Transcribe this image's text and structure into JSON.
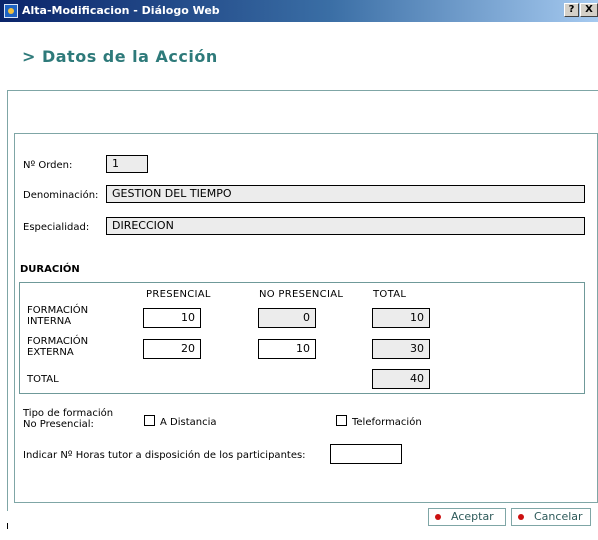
{
  "window": {
    "title": "Alta-Modificacion - Diálogo Web",
    "help_label": "?",
    "close_label": "X"
  },
  "heading": "> Datos de la Acción",
  "fields": {
    "orden": {
      "label": "Nº Orden:",
      "value": "1"
    },
    "denominacion": {
      "label": "Denominación:",
      "value": "GESTION DEL TIEMPO"
    },
    "especialidad": {
      "label": "Especialidad:",
      "value": "DIRECCION"
    }
  },
  "duracion": {
    "title": "DURACIÓN",
    "columns": [
      "PRESENCIAL",
      "NO PRESENCIAL",
      "TOTAL"
    ],
    "rows": [
      {
        "label_line1": "FORMACIÓN",
        "label_line2": "INTERNA",
        "presencial": "10",
        "no_presencial": "0",
        "total": "10"
      },
      {
        "label_line1": "FORMACIÓN",
        "label_line2": "EXTERNA",
        "presencial": "20",
        "no_presencial": "10",
        "total": "30"
      }
    ],
    "total_label": "TOTAL",
    "total_value": "40"
  },
  "tipo": {
    "label_line1": "Tipo de formación",
    "label_line2": "No Presencial:",
    "options": [
      "A Distancia",
      "Teleformación"
    ]
  },
  "horas_tutor": {
    "label": "Indicar Nº Horas tutor a disposición de los participantes:",
    "value": ""
  },
  "buttons": {
    "aceptar": "Aceptar",
    "cancelar": "Cancelar"
  }
}
